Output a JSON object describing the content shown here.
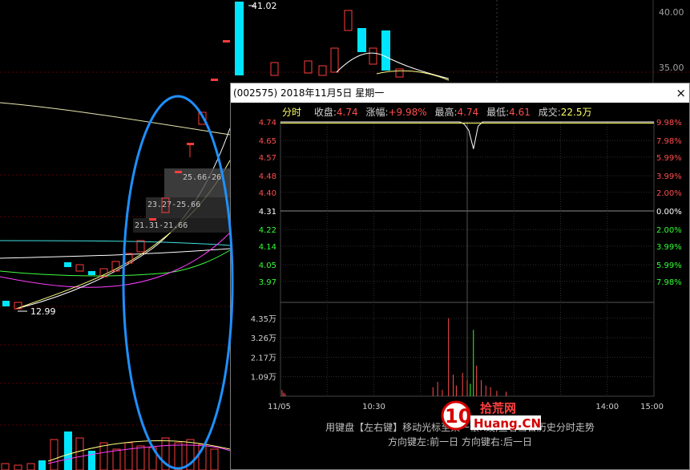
{
  "background": {
    "price_labels": [
      "40.00",
      "35.00"
    ],
    "high_label": "41.02",
    "low_label": "12.99",
    "zone_labels": [
      "25.66-26.",
      "23.27-25.66",
      "21.31-21.66"
    ]
  },
  "popup": {
    "title": "(002575) 2018年11月5日 星期一",
    "close_icon": "×",
    "quote": {
      "tab": "分时",
      "close_label": "收盘:",
      "close_value": "4.74",
      "change_label": "涨幅:",
      "change_value": "+9.98%",
      "high_label": "最高:",
      "high_value": "4.74",
      "low_label": "最低:",
      "low_value": "4.61",
      "volume_label": "成交:",
      "volume_value": "22.5万"
    },
    "chart_data": {
      "type": "line",
      "price_ticks": [
        "4.74",
        "4.65",
        "4.57",
        "4.48",
        "4.40",
        "4.31",
        "4.22",
        "4.14",
        "4.05",
        "3.97"
      ],
      "pct_ticks": [
        "9.98%",
        "7.98%",
        "5.99%",
        "3.99%",
        "2.00%",
        "0.00%",
        "2.00%",
        "3.99%",
        "5.99%",
        "7.98%"
      ],
      "volume_ticks": [
        "4.35万",
        "3.26万",
        "2.17万",
        "1.09万"
      ],
      "time_ticks": [
        "11/05",
        "10:30",
        "14:00",
        "15:00"
      ],
      "ylim": [
        3.88,
        4.74
      ],
      "reference_price": 4.31,
      "price_series": {
        "minutes": [
          0,
          60,
          115,
          118,
          121,
          124,
          127,
          130,
          133,
          136,
          240
        ],
        "values": [
          4.74,
          4.74,
          4.74,
          4.73,
          4.7,
          4.61,
          4.72,
          4.74,
          4.74,
          4.74,
          4.74
        ]
      },
      "volume_bars": [
        {
          "minute": 1,
          "volume": 0.35,
          "color": "red"
        },
        {
          "minute": 2,
          "volume": 0.2,
          "color": "red"
        },
        {
          "minute": 3,
          "volume": 0.15,
          "color": "red"
        },
        {
          "minute": 98,
          "volume": 0.5,
          "color": "red"
        },
        {
          "minute": 101,
          "volume": 0.8,
          "color": "red"
        },
        {
          "minute": 104,
          "volume": 0.35,
          "color": "red"
        },
        {
          "minute": 108,
          "volume": 4.35,
          "color": "red"
        },
        {
          "minute": 111,
          "volume": 1.2,
          "color": "red"
        },
        {
          "minute": 113,
          "volume": 0.6,
          "color": "red"
        },
        {
          "minute": 117,
          "volume": 1.3,
          "color": "red"
        },
        {
          "minute": 120,
          "volume": 0.9,
          "color": "red"
        },
        {
          "minute": 122,
          "volume": 0.7,
          "color": "green"
        },
        {
          "minute": 124,
          "volume": 3.7,
          "color": "green"
        },
        {
          "minute": 126,
          "volume": 1.7,
          "color": "red"
        },
        {
          "minute": 129,
          "volume": 0.9,
          "color": "red"
        },
        {
          "minute": 132,
          "volume": 0.6,
          "color": "red"
        },
        {
          "minute": 135,
          "volume": 0.5,
          "color": "red"
        },
        {
          "minute": 139,
          "volume": 0.3,
          "color": "red"
        },
        {
          "minute": 145,
          "volume": 0.25,
          "color": "red"
        }
      ],
      "volume_max": 5.1
    },
    "hint_line1": "用键盘【左右键】移动光标至某一根K线,查看当日历史分时走势",
    "hint_line2": "方向键左:前一日   方向键右:后一日"
  },
  "watermark": {
    "number": "10",
    "text_cn": "拾荒网",
    "text_en": "Huang.CN"
  },
  "colors": {
    "up": "#ff3b3b",
    "down": "#00e5ff",
    "price_line": "#ffffff",
    "ellipse": "#1e90ff",
    "grid": "#3a3a3a",
    "ticks_up": "#ff4d4d",
    "ticks_down": "#33ff33"
  }
}
